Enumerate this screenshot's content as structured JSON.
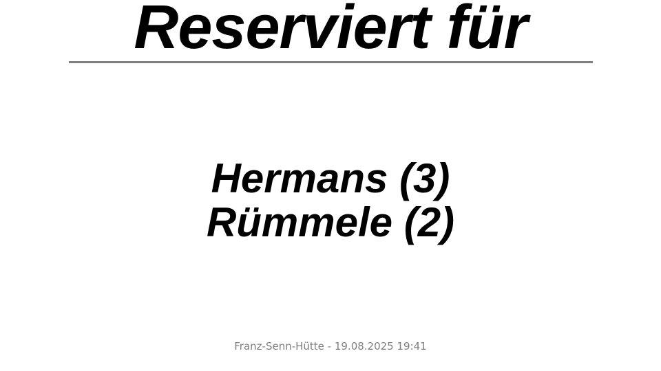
{
  "header": {
    "title": "Reserviert für"
  },
  "reservations": [
    {
      "label": "Hermans (3)"
    },
    {
      "label": "Rümmele (2)"
    }
  ],
  "footer": {
    "text": "Franz-Senn-Hütte - 19.08.2025 19:41"
  },
  "colors": {
    "text": "#000000",
    "divider": "#808080",
    "footer": "#808080",
    "background": "#ffffff"
  }
}
